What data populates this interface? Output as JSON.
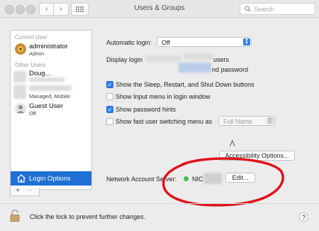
{
  "window": {
    "title": "Users & Groups",
    "search_placeholder": "Search"
  },
  "sidebar": {
    "current_user_label": "Current User",
    "current_user": {
      "name": "administrator",
      "role": "Admin"
    },
    "other_users_label": "Other Users",
    "other_users": [
      {
        "name": "Doug...",
        "role": ""
      },
      {
        "name": "",
        "role": "Managed, Mobile"
      },
      {
        "name": "Guest User",
        "role": "Off"
      }
    ],
    "login_options_label": "Login Options",
    "add_label": "+",
    "remove_label": "−"
  },
  "main": {
    "auto_login_label": "Automatic login:",
    "auto_login_value": "Off",
    "display_login_label": "Display login",
    "display_option_1_suffix": "users",
    "display_option_2_suffix": "nd password",
    "checkboxes": [
      {
        "label": "Show the Sleep, Restart, and Shut Down buttons",
        "checked": true
      },
      {
        "label": "Show Input menu in login window",
        "checked": false
      },
      {
        "label": "Show password hints",
        "checked": true
      },
      {
        "label": "Show fast user switching menu as",
        "checked": false
      }
    ],
    "fast_switch_value": "Full Name",
    "accessibility_button": "Accessibility Options...",
    "network_server_label": "Network Account Server:",
    "network_server_value": "NIC",
    "network_status_color": "#3ac150",
    "edit_button": "Edit..."
  },
  "footer": {
    "lock_text": "Click the lock to prevent further changes.",
    "help_label": "?"
  },
  "annotation_color": "#e0121b"
}
